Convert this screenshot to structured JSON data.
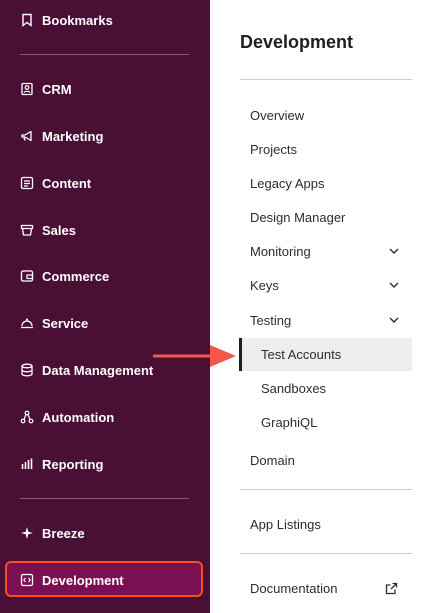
{
  "sidebar": {
    "items": [
      {
        "label": "Bookmarks",
        "icon": "bookmark-icon"
      },
      {
        "label": "CRM",
        "icon": "contacts-icon"
      },
      {
        "label": "Marketing",
        "icon": "megaphone-icon"
      },
      {
        "label": "Content",
        "icon": "content-icon"
      },
      {
        "label": "Sales",
        "icon": "sales-icon"
      },
      {
        "label": "Commerce",
        "icon": "commerce-icon"
      },
      {
        "label": "Service",
        "icon": "service-icon"
      },
      {
        "label": "Data Management",
        "icon": "database-icon"
      },
      {
        "label": "Automation",
        "icon": "automation-icon"
      },
      {
        "label": "Reporting",
        "icon": "reporting-icon"
      },
      {
        "label": "Breeze",
        "icon": "sparkle-icon"
      },
      {
        "label": "Development",
        "icon": "code-icon"
      }
    ],
    "active": "Development"
  },
  "panel": {
    "title": "Development",
    "items": [
      {
        "label": "Overview"
      },
      {
        "label": "Projects"
      },
      {
        "label": "Legacy Apps"
      },
      {
        "label": "Design Manager"
      },
      {
        "label": "Monitoring",
        "expandable": true
      },
      {
        "label": "Keys",
        "expandable": true
      },
      {
        "label": "Testing",
        "expandable": true,
        "expanded": true
      }
    ],
    "testing_children": [
      {
        "label": "Test Accounts",
        "selected": true
      },
      {
        "label": "Sandboxes"
      },
      {
        "label": "GraphiQL"
      }
    ],
    "domain": "Domain",
    "app_listings": "App Listings",
    "documentation": "Documentation"
  },
  "colors": {
    "sidebar_bg": "#4a0f34",
    "active_bg": "#7a0f52",
    "highlight_border": "#ff4c1f",
    "arrow": "#f2594b"
  }
}
